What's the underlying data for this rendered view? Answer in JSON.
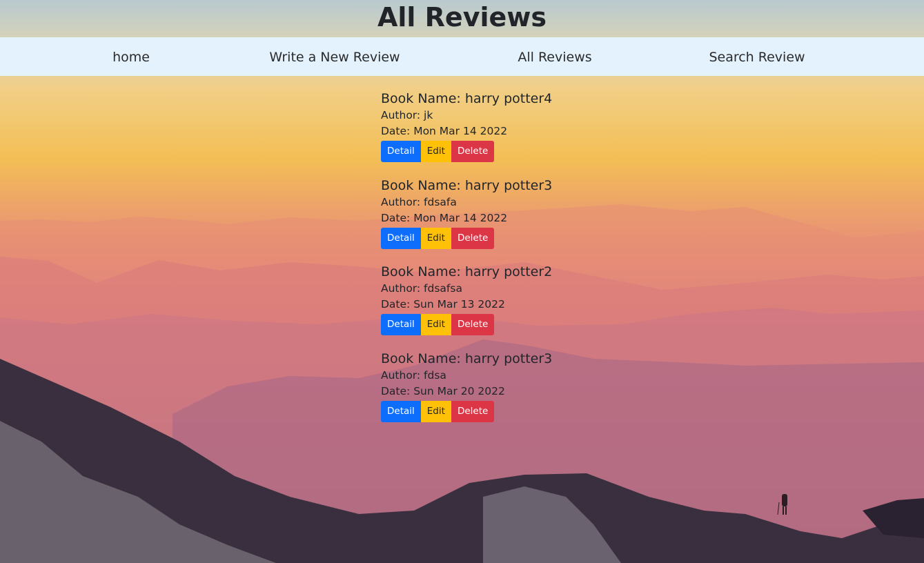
{
  "header": {
    "title": "All Reviews"
  },
  "nav": {
    "items": [
      {
        "label": "home"
      },
      {
        "label": "Write a New Review"
      },
      {
        "label": "All Reviews"
      },
      {
        "label": "Search Review"
      }
    ]
  },
  "reviews": [
    {
      "title": "Book Name: harry potter4",
      "author": "Author: jk",
      "date": "Date: Mon Mar 14 2022"
    },
    {
      "title": "Book Name: harry potter3",
      "author": "Author: fdsafa",
      "date": "Date: Mon Mar 14 2022"
    },
    {
      "title": "Book Name: harry potter2",
      "author": "Author: fdsafsa",
      "date": "Date: Sun Mar 13 2022"
    },
    {
      "title": "Book Name: harry potter3",
      "author": "Author: fdsa",
      "date": "Date: Sun Mar 20 2022"
    }
  ],
  "actions": {
    "detail_label": "Detail",
    "edit_label": "Edit",
    "delete_label": "Delete"
  },
  "colors": {
    "nav_bg": "#e3f2fd",
    "detail": "#0d6efd",
    "edit": "#ffc107",
    "delete": "#dc3545"
  }
}
